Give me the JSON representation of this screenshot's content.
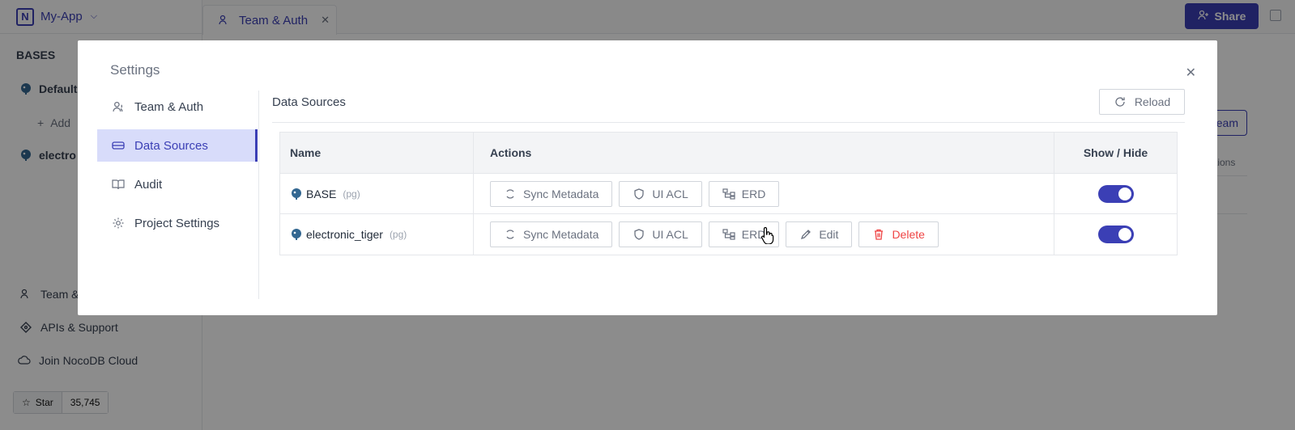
{
  "app": {
    "name": "My-App",
    "bases_title": "BASES",
    "bases": [
      "Default",
      "electro"
    ],
    "add_label": "Add",
    "bottom_items": [
      "Team &",
      "APIs & Support",
      "Join NocoDB Cloud"
    ],
    "star_label": "Star",
    "star_count": "35,745"
  },
  "header": {
    "tab_label": "Team & Auth",
    "share_label": "Share",
    "bg_team_label": "eam",
    "bg_actions_label": "tions"
  },
  "modal": {
    "title": "Settings",
    "menu": [
      {
        "label": "Team & Auth",
        "icon": "users-icon"
      },
      {
        "label": "Data Sources",
        "icon": "database-icon"
      },
      {
        "label": "Audit",
        "icon": "book-icon"
      },
      {
        "label": "Project Settings",
        "icon": "gear-icon"
      }
    ],
    "active_menu": "Data Sources",
    "section_title": "Data Sources",
    "reload_label": "Reload"
  },
  "table": {
    "columns": [
      "Name",
      "Actions",
      "Show / Hide"
    ],
    "rows": [
      {
        "name": "BASE",
        "type": "(pg)",
        "actions": [
          "Sync Metadata",
          "UI ACL",
          "ERD"
        ],
        "visible": true
      },
      {
        "name": "electronic_tiger",
        "type": "(pg)",
        "actions": [
          "Sync Metadata",
          "UI ACL",
          "ERD",
          "Edit",
          "Delete"
        ],
        "visible": true
      }
    ]
  },
  "colors": {
    "accent": "#3b3fb5",
    "danger": "#ef4444",
    "active_menu_bg": "#d8dcfa"
  }
}
